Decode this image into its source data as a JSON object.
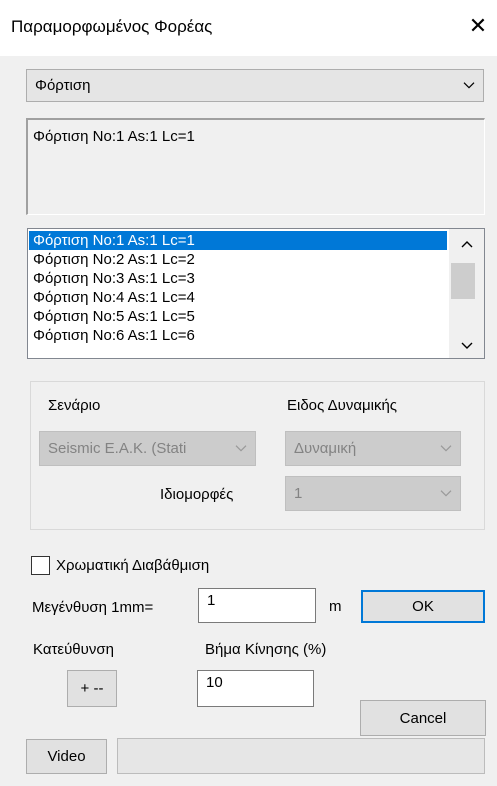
{
  "window": {
    "title": "Παραμορφωμένος Φορέας",
    "close_glyph": "✕"
  },
  "view_select": {
    "value": "Φόρτιση"
  },
  "info_box": {
    "text": "Φόρτιση No:1 As:1 Lc=1"
  },
  "load_list": {
    "selected_index": 0,
    "items": [
      "Φόρτιση No:1 As:1 Lc=1",
      "Φόρτιση No:2 As:1 Lc=2",
      "Φόρτιση No:3 As:1 Lc=3",
      "Φόρτιση No:4 As:1 Lc=4",
      "Φόρτιση No:5 As:1 Lc=5",
      "Φόρτιση No:6 As:1 Lc=6"
    ]
  },
  "scenario_group": {
    "scenario_label": "Σενάριο",
    "scenario_value": "Seismic E.A.K. (Stati",
    "dynamics_label": "Ειδος Δυναμικής",
    "dynamics_value": "Δυναμική",
    "modes_label": "Ιδιομορφές",
    "modes_value": "1",
    "disabled": true
  },
  "color_gradation": {
    "label": "Χρωματική Διαβάθμιση",
    "checked": false
  },
  "magnification": {
    "label": "Μεγένθυση 1mm=",
    "value": "1",
    "unit": "m"
  },
  "ok_button": {
    "label": "OK"
  },
  "direction": {
    "label": "Κατεύθυνση",
    "button": "+ --"
  },
  "motion_step": {
    "label": "Βήμα Κίνησης (%)",
    "value": "10"
  },
  "cancel_button": {
    "label": "Cancel"
  },
  "video_button": {
    "label": "Video"
  },
  "colors": {
    "selection": "#0078d7",
    "default_border": "#0078d7",
    "disabled_text": "#838383"
  },
  "icons": {
    "dropdown": "chevron-down-icon",
    "scroll_up": "scroll-up-arrow-icon",
    "scroll_down": "scroll-down-arrow-icon"
  }
}
